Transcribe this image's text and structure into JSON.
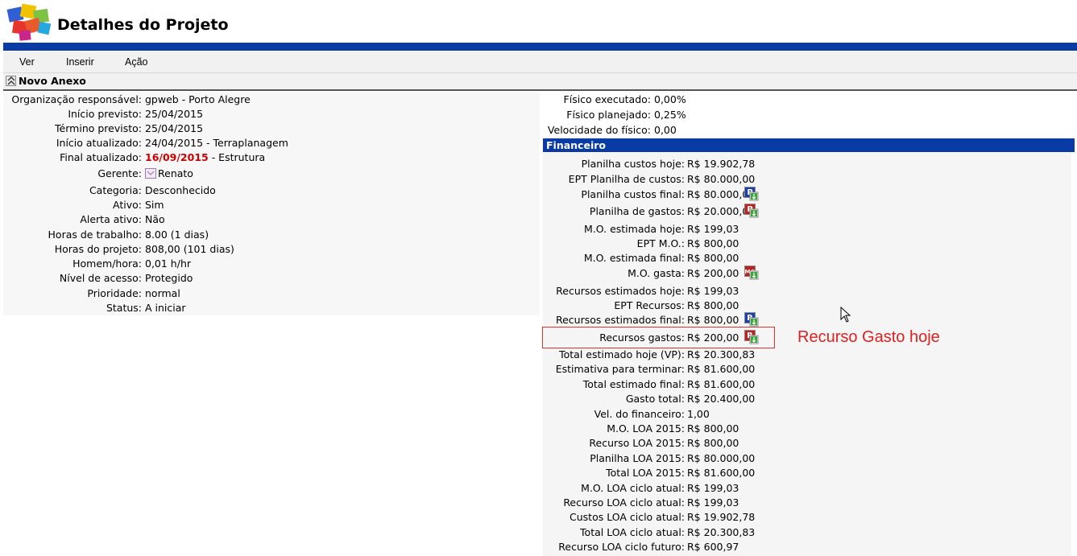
{
  "header": {
    "title": "Detalhes do Projeto",
    "logo_icon": "puzzle-logo-icon"
  },
  "menu": {
    "items": [
      "Ver",
      "Inserir",
      "Ação"
    ]
  },
  "section": {
    "title": "Novo Anexo"
  },
  "left_fields": [
    {
      "label": "Organização responsável:",
      "value": "gpweb - Porto Alegre"
    },
    {
      "label": "Início previsto:",
      "value": "25/04/2015"
    },
    {
      "label": "Término previsto:",
      "value": "25/04/2015"
    },
    {
      "label": "Início atualizado:",
      "value": "24/04/2015 - Terraplanagem"
    },
    {
      "label": "Final atualizado:",
      "value_highlight": "16/09/2015",
      "value": " - Estrutura"
    },
    {
      "label": "Gerente:",
      "value": "Renato"
    },
    {
      "label": "Categoria:",
      "value": "Desconhecido"
    },
    {
      "label": "Ativo:",
      "value": "Sim"
    },
    {
      "label": "Alerta ativo:",
      "value": "Não"
    },
    {
      "label": "Horas de trabalho:",
      "value": "8.00 (1 dias)"
    },
    {
      "label": "Horas do projeto:",
      "value": "808,00 (101 dias)"
    },
    {
      "label": "Homem/hora:",
      "value": "0,01 h/hr"
    },
    {
      "label": "Nível de acesso:",
      "value": "Protegido"
    },
    {
      "label": "Prioridade:",
      "value": "normal"
    },
    {
      "label": "Status:",
      "value": "A iniciar"
    }
  ],
  "right_top_fields": [
    {
      "label": "Físico executado:",
      "value": "0,00%"
    },
    {
      "label": "Físico planejado:",
      "value": "0,25%"
    },
    {
      "label": "Velocidade do físico:",
      "value": "0,00"
    }
  ],
  "financeiro": {
    "title": "Financeiro",
    "rows": [
      {
        "label": "Planilha custos hoje:",
        "value": "R$ 19.902,78"
      },
      {
        "label": "EPT Planilha de custos:",
        "value": "R$ 80.000,00"
      },
      {
        "label": "Planilha custos final:",
        "value": "R$ 80.000,00",
        "icon": "P",
        "icon_color": "#1a3fb0"
      },
      {
        "label": "Planilha de gastos:",
        "value": "R$ 20.000,00",
        "icon": "P",
        "icon_color": "#c02020"
      },
      {
        "label": "M.O. estimada hoje:",
        "value": "R$ 199,03"
      },
      {
        "label": "EPT M.O.:",
        "value": "R$ 800,00"
      },
      {
        "label": "M.O. estimada final:",
        "value": "R$ 800,00"
      },
      {
        "label": "M.O. gasta:",
        "value": "R$ 200,00",
        "icon": "MO",
        "icon_color": "#c02020"
      },
      {
        "label": "Recursos estimados hoje:",
        "value": "R$ 199,03"
      },
      {
        "label": "EPT Recursos:",
        "value": "R$ 800,00"
      },
      {
        "label": "Recursos estimados final:",
        "value": "R$ 800,00",
        "icon": "R",
        "icon_color": "#1a3fb0"
      },
      {
        "label": "Recursos gastos:",
        "value": "R$ 200,00",
        "icon": "R",
        "icon_color": "#c02020"
      },
      {
        "label": "Total estimado hoje (VP):",
        "value": "R$ 20.300,83"
      },
      {
        "label": "Estimativa para terminar:",
        "value": "R$ 81.600,00"
      },
      {
        "label": "Total estimado final:",
        "value": "R$ 81.600,00"
      },
      {
        "label": "Gasto total:",
        "value": "R$ 20.400,00"
      },
      {
        "label": "Vel. do financeiro:",
        "value": "1,00"
      },
      {
        "label": "M.O. LOA 2015:",
        "value": "R$ 800,00"
      },
      {
        "label": "Recurso LOA 2015:",
        "value": "R$ 800,00"
      },
      {
        "label": "Planilha LOA 2015:",
        "value": "R$ 80.000,00"
      },
      {
        "label": "Total LOA 2015:",
        "value": "R$ 81.600,00"
      },
      {
        "label": "M.O. LOA ciclo atual:",
        "value": "R$ 199,03"
      },
      {
        "label": "Recurso LOA ciclo atual:",
        "value": "R$ 199,03"
      },
      {
        "label": "Custos LOA ciclo atual:",
        "value": "R$ 19.902,78"
      },
      {
        "label": "Total LOA ciclo atual:",
        "value": "R$ 20.300,83"
      },
      {
        "label": "Recurso LOA ciclo futuro:",
        "value": "R$ 600,97"
      }
    ]
  },
  "annotation": {
    "text": "Recurso Gasto hoje",
    "color": "#e02020"
  },
  "colors": {
    "brand_blue": "#0a3aa3",
    "date_red": "#cc0000"
  }
}
